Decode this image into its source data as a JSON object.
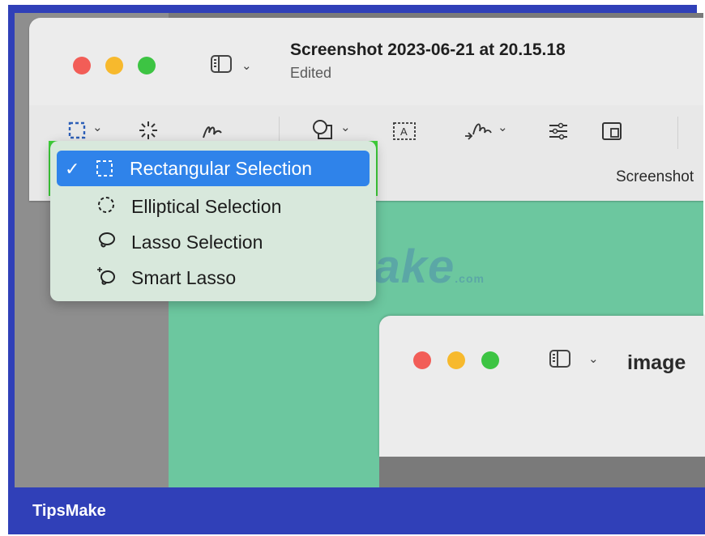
{
  "window": {
    "title": "Screenshot 2023-06-21 at 20.15.18",
    "subtitle": "Edited",
    "toolbar_label": "Screenshot"
  },
  "menu": {
    "items": [
      {
        "label": "Rectangular Selection",
        "icon": "rectangle-selection-icon",
        "selected": true
      },
      {
        "label": "Elliptical Selection",
        "icon": "ellipse-selection-icon",
        "selected": false
      },
      {
        "label": "Lasso Selection",
        "icon": "lasso-icon",
        "selected": false
      },
      {
        "label": "Smart Lasso",
        "icon": "smart-lasso-icon",
        "selected": false
      }
    ]
  },
  "window2": {
    "title": "image"
  },
  "footer": {
    "brand": "TipsMake"
  },
  "watermark": {
    "text": "TipsMake",
    "suffix": ".com"
  },
  "colors": {
    "close": "#f25d57",
    "minimize": "#f7b92d",
    "zoom": "#3dc443",
    "highlight_green": "#3fd13a",
    "selection_blue": "#2f83ea",
    "brand_bar": "#3040b8",
    "canvas_green": "#6cc79f"
  }
}
